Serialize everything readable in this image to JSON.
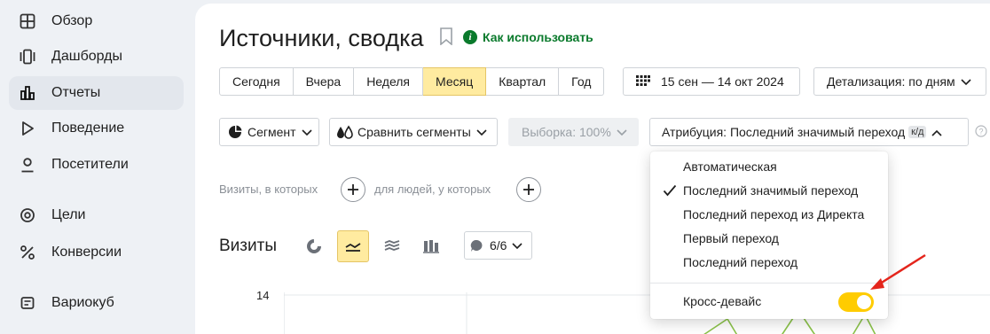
{
  "sidebar": {
    "items": [
      {
        "label": "Обзор",
        "icon": "grid-icon"
      },
      {
        "label": "Дашборды",
        "icon": "dashboards-icon"
      },
      {
        "label": "Отчеты",
        "icon": "bar-chart-icon",
        "active": true
      },
      {
        "label": "Поведение",
        "icon": "play-icon"
      },
      {
        "label": "Посетители",
        "icon": "user-icon"
      },
      {
        "label": "Цели",
        "icon": "target-icon"
      },
      {
        "label": "Конверсии",
        "icon": "percent-icon"
      },
      {
        "label": "Вариокуб",
        "icon": "cube-icon"
      }
    ]
  },
  "header": {
    "title": "Источники, сводка",
    "howto_label": "Как использовать"
  },
  "periods": [
    "Сегодня",
    "Вчера",
    "Неделя",
    "Месяц",
    "Квартал",
    "Год"
  ],
  "active_period": "Месяц",
  "date_range": "15 сен — 14 окт 2024",
  "detail_label": "Детализация: по дням",
  "controls": {
    "segment": "Сегмент",
    "compare": "Сравнить сегменты",
    "sample": "Выборка: 100%",
    "attribution": "Атрибуция: Последний значимый переход",
    "attribution_badge": "к/д"
  },
  "filters": {
    "visits_where": "Визиты, в которых",
    "people_where": "для людей, у которых"
  },
  "chart_section": {
    "title": "Визиты",
    "series_count": "6/6",
    "y_tick": "14"
  },
  "attribution_menu": {
    "options": [
      "Автоматическая",
      "Последний значимый переход",
      "Последний переход из Директа",
      "Первый переход",
      "Последний переход"
    ],
    "selected": "Последний значимый переход",
    "cross_device_label": "Кросс-девайс",
    "cross_device_on": true
  },
  "colors": {
    "accent_yellow": "#ffeba0",
    "toggle_on": "#ffcc00",
    "link_green": "#0a7a2c",
    "arrow_red": "#e4251c",
    "chart_line": "#8bc34a"
  }
}
